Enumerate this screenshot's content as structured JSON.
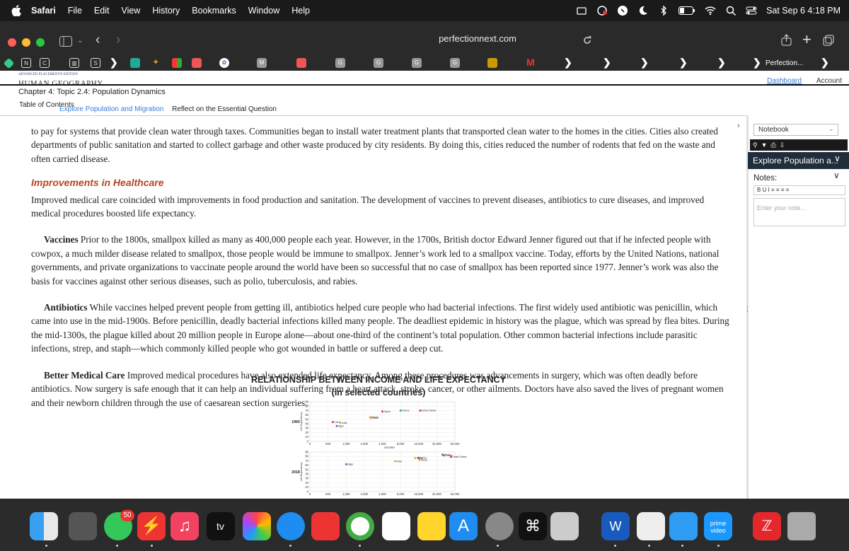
{
  "menubar": {
    "app": "Safari",
    "items": [
      "File",
      "Edit",
      "View",
      "History",
      "Bookmarks",
      "Window",
      "Help"
    ],
    "clock": "Sat Sep 6  4:18 PM"
  },
  "browser": {
    "url": "perfectionnext.com",
    "favorites_last": "Perfection..."
  },
  "site": {
    "edition": "ADVANCED PLACEMENT® EDITION",
    "brand": "HUMAN GEOGRAPHY",
    "chapter": "Chapter 4: Topic 2.4: Population Dynamics",
    "nav": [
      "Dashboard",
      "Account"
    ],
    "toc": "Table of Contents",
    "tabs": [
      "Explore Population and Migration",
      "Reflect on the Essential Question"
    ]
  },
  "content": {
    "p1": "to pay for systems that provide clean water through taxes. Communities began to install water treatment plants that transported clean water to the homes in the cities. Cities also created departments of public sanitation and started to collect garbage and other waste produced by city residents. By doing this, cities reduced the number of rodents that fed on the waste and often carried disease.",
    "h_health": "Improvements in Healthcare",
    "p2": "Improved medical care coincided with improvements in food production and sanitation. The development of vaccines to prevent diseases, antibiotics to cure diseases, and improved medical procedures boosted life expectancy.",
    "vacc_lead": "Vaccines",
    "vacc_text": " Prior to the 1800s, smallpox killed as many as 400,000 people each year. However, in the 1700s, British doctor Edward Jenner figured out that if he infected people with cowpox, a much milder disease related to smallpox, those people would be immune to smallpox. Jenner’s work led to a smallpox vaccine. Today, efforts by the United Nations, national governments, and private organizations to vaccinate people around the world have been so successful that no case of smallpox has been reported since 1977. Jenner’s work was also the basis for vaccines against other serious diseases, such as polio, tuberculosis, and rabies.",
    "anti_lead": "Antibiotics",
    "anti_text": " While vaccines helped prevent people from getting ill, antibiotics helped cure people who had bacterial infections. The first widely used antibiotic was penicillin, which came into use in the mid-1900s. Before penicillin, deadly bacterial infections killed many people. The deadliest epidemic in history was the plague, which was spread by flea bites. During the mid-1300s, the plague killed about 20 million people in Europe alone—about one-third of the continent’s total population. Other common bacterial infections include parasitic infections, strep, and staph—which commonly killed people who got wounded in battle or suffered a deep cut.",
    "care_lead": "Better Medical Care",
    "care_text": " Improved medical procedures have also extended life expectancy. Among these procedures was advancements in surgery, which was often deadly before antibiotics. Now surgery is safe enough that it can help an individual suffering from a heart attack, stroke, cancer, or other ailments. Doctors have also saved the lives of pregnant women and their newborn children through the use of caesarean section surgeries."
  },
  "chart_data": {
    "type": "scatter",
    "title": "RELATIONSHIP BETWEEN INCOME AND LIFE EXPECTANCY",
    "subtitle": "(in selected countries)",
    "xlabel": "Income",
    "ylabel": "Life Expectancy",
    "x_ticks": [
      "0",
      "500",
      "1,000",
      "2,000",
      "4,000",
      "8,000",
      "16,000",
      "32,000",
      "64,000"
    ],
    "y_ticks": [
      "90",
      "80",
      "70",
      "60",
      "50",
      "40",
      "30",
      "20",
      "10",
      "0"
    ],
    "ylim": [
      0,
      90
    ],
    "log_x": true,
    "panels": [
      {
        "name": "1960",
        "points": [
          {
            "label": "United States",
            "x": 17000,
            "y": 70,
            "color": "#d9262b"
          },
          {
            "label": "France",
            "x": 8000,
            "y": 70,
            "color": "#2aa84a"
          },
          {
            "label": "Japan",
            "x": 4000,
            "y": 68,
            "color": "#d9262b"
          },
          {
            "label": "Brazil",
            "x": 2500,
            "y": 55,
            "color": "#e8a020"
          },
          {
            "label": "World",
            "x": 2600,
            "y": 53,
            "color": "#e8a020"
          },
          {
            "label": "China",
            "x": 600,
            "y": 44,
            "color": "#d9262b"
          },
          {
            "label": "India",
            "x": 800,
            "y": 42,
            "color": "#e8a020"
          },
          {
            "label": "Niger",
            "x": 700,
            "y": 35,
            "color": "#2a66c0"
          }
        ]
      },
      {
        "name": "2018",
        "points": [
          {
            "label": "Japan",
            "x": 40000,
            "y": 84,
            "color": "#d9262b"
          },
          {
            "label": "France",
            "x": 42000,
            "y": 82,
            "color": "#2aa84a"
          },
          {
            "label": "United States",
            "x": 55000,
            "y": 79,
            "color": "#d9262b"
          },
          {
            "label": "Brazil",
            "x": 14000,
            "y": 76,
            "color": "#e8a020"
          },
          {
            "label": "China",
            "x": 16000,
            "y": 77,
            "color": "#d9262b"
          },
          {
            "label": "World",
            "x": 16500,
            "y": 72,
            "color": "#e8a020"
          },
          {
            "label": "India",
            "x": 6500,
            "y": 69,
            "color": "#e8a020"
          },
          {
            "label": "Niger",
            "x": 1000,
            "y": 62,
            "color": "#2a66c0"
          }
        ]
      }
    ]
  },
  "sidebar": {
    "notebook": "Notebook",
    "section": "Explore Population a...",
    "notes_label": "Notes:",
    "format_tools": "B  U  I    ≡  ≡    ≡  ≡",
    "placeholder": "Enter your note..."
  },
  "dock": {
    "badge": "50",
    "tv_label": " tv",
    "prime_label": "prime video"
  }
}
